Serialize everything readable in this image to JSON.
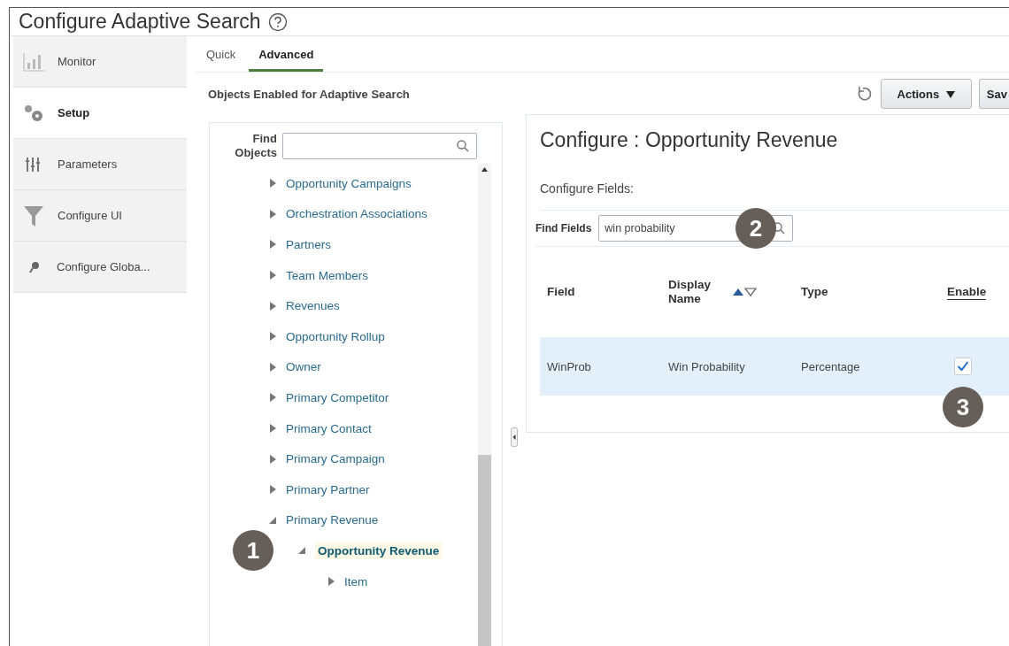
{
  "window": {
    "title": "Configure Adaptive Search"
  },
  "sidebar": {
    "items": [
      {
        "label": "Monitor",
        "kind": "chart",
        "selected": false
      },
      {
        "label": "Setup",
        "kind": "gears",
        "selected": true
      },
      {
        "label": "Parameters",
        "kind": "sliders",
        "selected": false
      },
      {
        "label": "Configure UI",
        "kind": "funnel",
        "selected": false
      },
      {
        "label": "Configure Globa...",
        "kind": "pin",
        "selected": false
      }
    ]
  },
  "tabs": [
    {
      "label": "Quick",
      "selected": false
    },
    {
      "label": "Advanced",
      "selected": true
    }
  ],
  "objects_panel": {
    "title": "Objects Enabled for Adaptive Search",
    "find_label": "Find Objects",
    "tree": [
      {
        "label": "Opportunity Campaigns",
        "expanded": false,
        "selected": false
      },
      {
        "label": "Orchestration Associations",
        "expanded": false,
        "selected": false
      },
      {
        "label": "Partners",
        "expanded": false,
        "selected": false
      },
      {
        "label": "Team Members",
        "expanded": false,
        "selected": false
      },
      {
        "label": "Revenues",
        "expanded": false,
        "selected": false
      },
      {
        "label": "Opportunity Rollup",
        "expanded": false,
        "selected": false
      },
      {
        "label": "Owner",
        "expanded": false,
        "selected": false
      },
      {
        "label": "Primary Competitor",
        "expanded": false,
        "selected": false
      },
      {
        "label": "Primary Contact",
        "expanded": false,
        "selected": false
      },
      {
        "label": "Primary Campaign",
        "expanded": false,
        "selected": false
      },
      {
        "label": "Primary Partner",
        "expanded": false,
        "selected": false
      },
      {
        "label": "Primary Revenue",
        "expanded": true,
        "selected": false,
        "children": [
          {
            "label": "Opportunity Revenue",
            "expanded": true,
            "selected": true,
            "callout": "1",
            "children": [
              {
                "label": "Item",
                "expanded": false,
                "selected": false
              }
            ]
          }
        ]
      }
    ]
  },
  "toolbar": {
    "actions": "Actions",
    "save": "Sav"
  },
  "config_panel": {
    "title": "Configure : Opportunity Revenue",
    "subtitle": "Configure Fields:",
    "find_label": "Find Fields",
    "find_value": "win probability",
    "find_callout": "2",
    "columns": [
      {
        "label": "Field",
        "kind": "plain"
      },
      {
        "label": "Display Name",
        "kind": "sortable"
      },
      {
        "label": "Type",
        "kind": "plain"
      },
      {
        "label": "Enable",
        "kind": "underlined"
      }
    ],
    "rows": [
      {
        "field": "WinProb",
        "display_name": "Win Probability",
        "type": "Percentage",
        "enabled": true,
        "selected": true,
        "callout": "3"
      }
    ]
  }
}
